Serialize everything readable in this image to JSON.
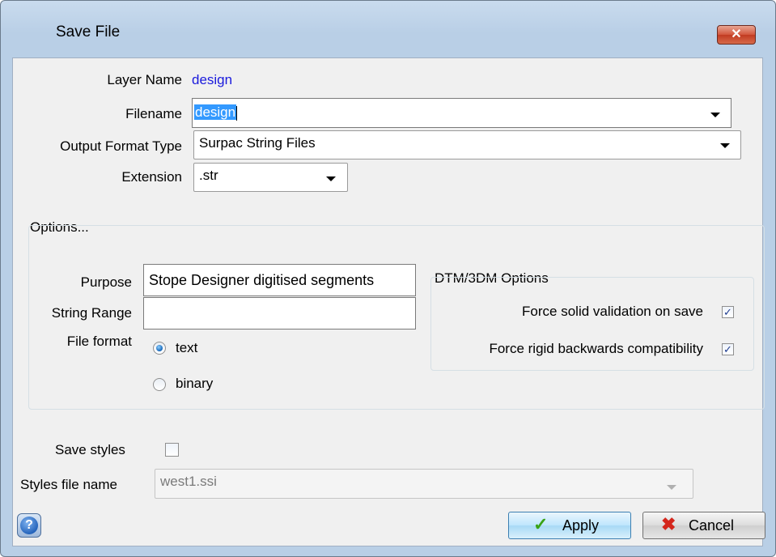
{
  "window": {
    "title": "Save File",
    "close_label": "✕"
  },
  "layer": {
    "label": "Layer Name",
    "value": "design"
  },
  "filename": {
    "label": "Filename",
    "value": "design"
  },
  "output_format": {
    "label": "Output Format Type",
    "value": "Surpac String Files"
  },
  "extension": {
    "label": "Extension",
    "value": ".str"
  },
  "options": {
    "label": "Options...",
    "purpose": {
      "label": "Purpose",
      "value": "Stope Designer digitised segments"
    },
    "string_range": {
      "label": "String Range",
      "value": ""
    },
    "file_format": {
      "label": "File format",
      "options": [
        "text",
        "binary"
      ],
      "selected": "text"
    },
    "dtm": {
      "label": "DTM/3DM Options",
      "force_solid": {
        "label": "Force solid validation on save",
        "checked": true
      },
      "force_rigid": {
        "label": "Force rigid backwards compatibility",
        "checked": true
      }
    }
  },
  "save_styles": {
    "label": "Save styles",
    "checked": false
  },
  "styles_file": {
    "label": "Styles file name",
    "value": "west1.ssi"
  },
  "buttons": {
    "help": "?",
    "apply": "Apply",
    "cancel": "Cancel"
  },
  "icons": {
    "check_mark": "✓",
    "apply_icon": "checkmark-icon",
    "cancel_icon": "red-x-icon"
  },
  "colors": {
    "layer_value": "#1a1adc",
    "selection": "#3399ff",
    "cancel_x": "#d4261c",
    "apply_check": "#3aa316"
  }
}
